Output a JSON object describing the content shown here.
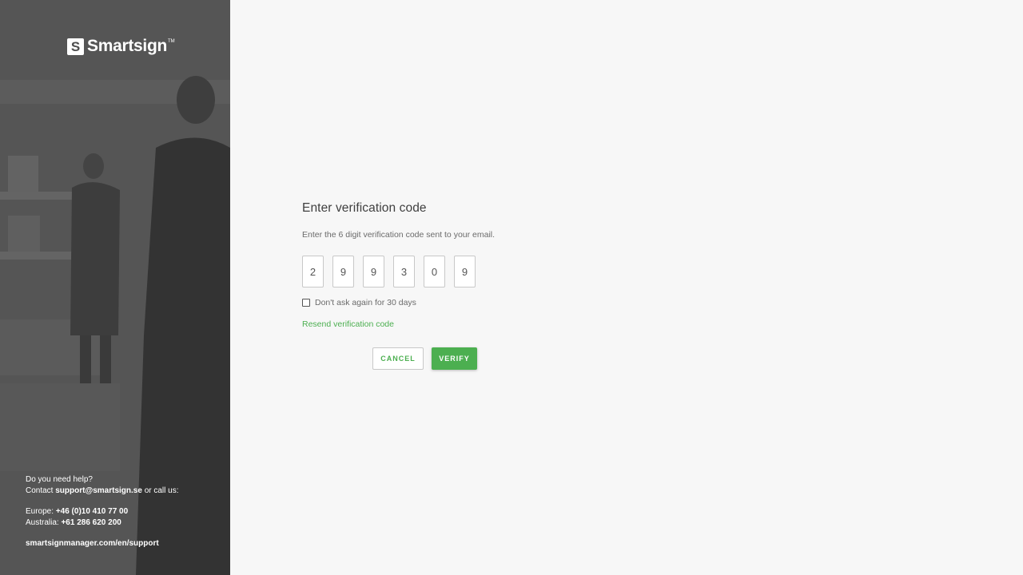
{
  "sidebar": {
    "brand": {
      "name": "Smartsign",
      "trademark": "TM",
      "mark_letter": "S"
    },
    "help": {
      "line1": "Do you need help?",
      "contact_prefix": "Contact ",
      "contact_email": "support@smartsign.se",
      "contact_suffix": " or call us:",
      "europe_label": "Europe: ",
      "europe_phone": "+46 (0)10 410 77 00",
      "australia_label": "Australia: ",
      "australia_phone": "+61 286 620 200",
      "support_url": "smartsignmanager.com/en/support"
    }
  },
  "verification": {
    "title": "Enter verification code",
    "subtitle": "Enter the 6 digit verification code sent to your email.",
    "digits": [
      "2",
      "9",
      "9",
      "3",
      "0",
      "9"
    ],
    "remember_label": "Don't ask again for 30 days",
    "remember_checked": false,
    "resend_label": "Resend verification code",
    "cancel_label": "CANCEL",
    "verify_label": "VERIFY"
  },
  "colors": {
    "accent": "#4caf50",
    "sidebar": "#4a4a4a",
    "background": "#f7f7f7"
  }
}
